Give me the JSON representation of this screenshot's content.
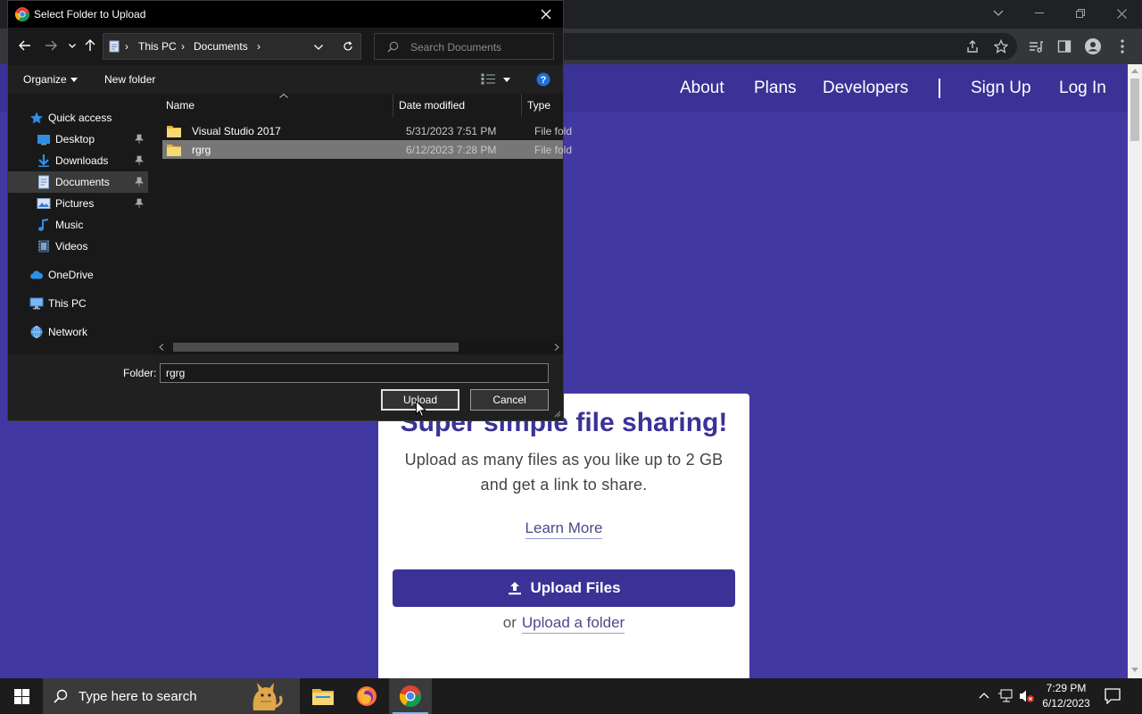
{
  "dialog": {
    "title": "Select Folder to Upload",
    "breadcrumbs": [
      "This PC",
      "Documents"
    ],
    "search_placeholder": "Search Documents",
    "commands": {
      "organize": "Organize",
      "new_folder": "New folder"
    },
    "nav_items": [
      {
        "label": "Quick access",
        "icon": "star-icon"
      },
      {
        "label": "Desktop",
        "icon": "desktop-icon",
        "pinned": true
      },
      {
        "label": "Downloads",
        "icon": "download-icon",
        "pinned": true
      },
      {
        "label": "Documents",
        "icon": "document-icon",
        "pinned": true,
        "selected": true
      },
      {
        "label": "Pictures",
        "icon": "picture-icon",
        "pinned": true
      },
      {
        "label": "Music",
        "icon": "music-icon"
      },
      {
        "label": "Videos",
        "icon": "video-icon"
      },
      {
        "label": "OneDrive",
        "icon": "cloud-icon"
      },
      {
        "label": "This PC",
        "icon": "computer-icon"
      },
      {
        "label": "Network",
        "icon": "network-icon"
      }
    ],
    "columns": [
      "Name",
      "Date modified",
      "Type"
    ],
    "files": [
      {
        "name": "Visual Studio 2017",
        "date": "5/31/2023 7:51 PM",
        "type": "File fold"
      },
      {
        "name": "rgrg",
        "date": "6/12/2023 7:28 PM",
        "type": "File fold",
        "selected": true
      }
    ],
    "folder_label": "Folder:",
    "folder_value": "rgrg",
    "upload_label": "Upload",
    "cancel_label": "Cancel"
  },
  "site": {
    "nav": [
      "About",
      "Plans",
      "Developers",
      "Sign Up",
      "Log In"
    ],
    "headline": "Super simple file sharing!",
    "subtext": "Upload as many files as you like up to 2 GB and get a link to share.",
    "learn_more": "Learn More",
    "upload_files": "Upload Files",
    "or_text": "or",
    "upload_folder": "Upload a folder"
  },
  "taskbar": {
    "search_placeholder": "Type here to search",
    "time": "7:29 PM",
    "date": "6/12/2023"
  },
  "colors": {
    "page_bg": "#4238a2",
    "brand": "#3a3296",
    "dialog_bg": "#202020",
    "selection": "#777777"
  }
}
